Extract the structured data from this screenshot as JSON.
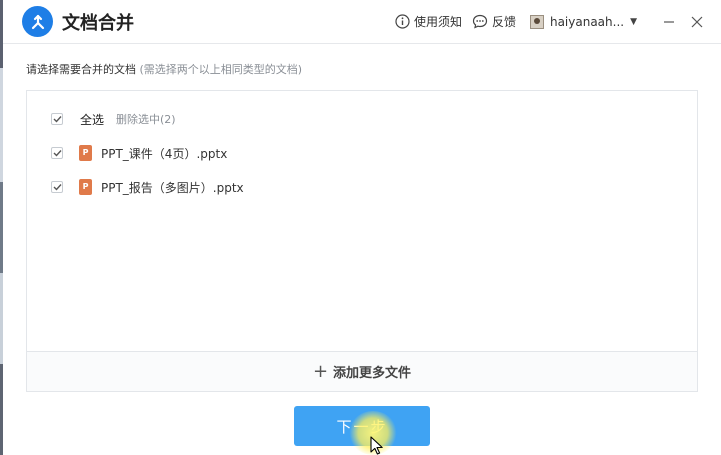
{
  "app": {
    "title": "文档合并",
    "logo_icon": "merge-logo-icon",
    "brand_color": "#1e7ee6"
  },
  "titlebar": {
    "help_label": "使用须知",
    "feedback_label": "反馈",
    "username": "haiyanaah...",
    "icons": [
      "info-icon",
      "chat-icon",
      "avatar",
      "caret-down-icon",
      "minimize-icon",
      "close-icon"
    ]
  },
  "instruction": {
    "main": "请选择需要合并的文档",
    "hint": "(需选择两个以上相同类型的文档)"
  },
  "file_list": {
    "select_all_label": "全选",
    "delete_selected_label": "删除选中(2)",
    "select_all_checked": true,
    "files": [
      {
        "name": "PPT_课件（4页）.pptx",
        "checked": true,
        "icon": "ppt-file-icon"
      },
      {
        "name": "PPT_报告（多图片）.pptx",
        "checked": true,
        "icon": "ppt-file-icon"
      }
    ]
  },
  "add_more_label": "添加更多文件",
  "next_button_label": "下一步",
  "colors": {
    "primary_button": "#3fa3f3",
    "ppt_icon": "#e07a4a",
    "hint_text": "#8a8f96"
  }
}
